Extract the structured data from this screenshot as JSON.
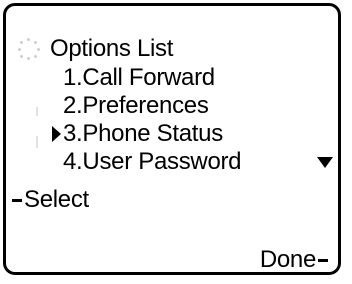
{
  "screen": {
    "title": "Options List"
  },
  "menu": {
    "items": [
      {
        "label": "1.Call Forward"
      },
      {
        "label": "2.Preferences"
      },
      {
        "label": "3.Phone Status",
        "selected": true
      },
      {
        "label": "4.User Password"
      }
    ],
    "selected_index": 2,
    "more_below": true
  },
  "softkeys": {
    "left": "Select",
    "right": "Done"
  },
  "icons": {
    "busy": "loading-spinner-icon",
    "cursor": "selection-arrow-icon",
    "scroll": "scroll-down-arrow-icon"
  }
}
